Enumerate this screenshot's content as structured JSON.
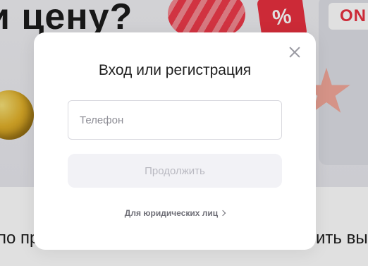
{
  "background": {
    "heading": "и цену?",
    "discount_badge": "%",
    "online_badge": "ON",
    "text_left": "по пр",
    "text_right": "ить вы"
  },
  "modal": {
    "title": "Вход или регистрация",
    "phone_placeholder": "Телефон",
    "phone_value": "",
    "continue_label": "Продолжить",
    "legal_link": "Для юридических лиц"
  },
  "colors": {
    "accent_red": "#e9303f",
    "disabled_button_bg": "#f2f2f6",
    "disabled_button_text": "#b9b9c1"
  }
}
